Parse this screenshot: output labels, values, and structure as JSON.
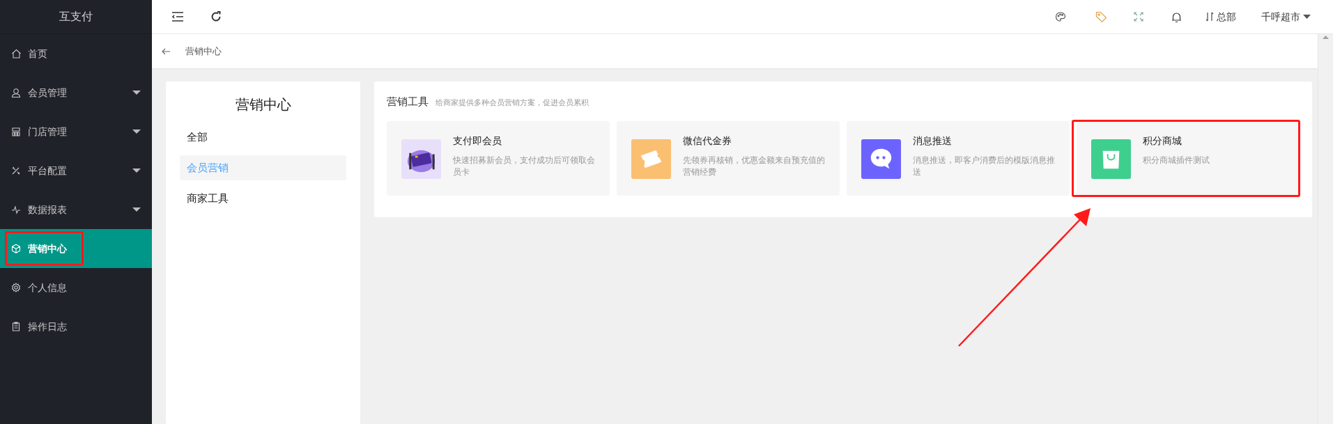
{
  "sidebar": {
    "logo": "互支付",
    "items": [
      {
        "label": "首页",
        "kind": "link",
        "selected": false
      },
      {
        "label": "会员管理",
        "kind": "group",
        "selected": false,
        "expanded": false
      },
      {
        "label": "门店管理",
        "kind": "group",
        "selected": false,
        "expanded": false
      },
      {
        "label": "平台配置",
        "kind": "group",
        "selected": false,
        "expanded": false
      },
      {
        "label": "数据报表",
        "kind": "group",
        "selected": false,
        "expanded": false
      },
      {
        "label": "营销中心",
        "kind": "link",
        "selected": true
      },
      {
        "label": "个人信息",
        "kind": "link",
        "selected": false
      },
      {
        "label": "操作日志",
        "kind": "link",
        "selected": false
      }
    ]
  },
  "topbar": {
    "branch": "总部",
    "store": "千呼超市"
  },
  "breadcrumb": "营销中心",
  "category_panel": {
    "title": "营销中心",
    "items": [
      {
        "label": "全部",
        "selected": false
      },
      {
        "label": "会员营销",
        "selected": true
      },
      {
        "label": "商家工具",
        "selected": false
      }
    ]
  },
  "tools_panel": {
    "title": "营销工具",
    "subtitle": "给商家提供多种会员营销方案，促进会员累积",
    "cards": [
      {
        "title": "支付即会员",
        "description": "快速招募新会员，支付成功后可领取会员卡",
        "kind": "illustration",
        "color": "#e8e0fa"
      },
      {
        "title": "微信代金券",
        "description": "先领券再核销，优惠金额来自预充值的营销经费",
        "kind": "ticket",
        "color": "#fbbf72"
      },
      {
        "title": "消息推送",
        "description": "消息推送，即客户消费后的模版消息推送",
        "kind": "chat",
        "color": "#6c63ff"
      },
      {
        "title": "积分商城",
        "description": "积分商城插件测试",
        "kind": "bag",
        "color": "#3ecf8e"
      }
    ]
  }
}
